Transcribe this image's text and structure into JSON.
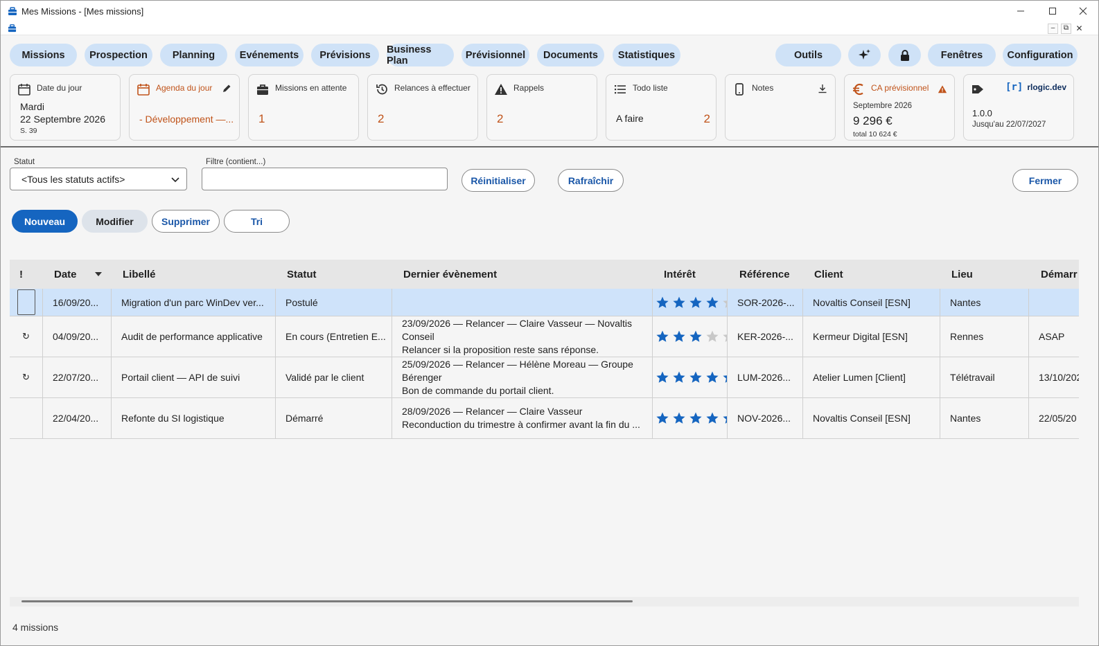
{
  "window": {
    "title": "Mes Missions - [Mes missions]"
  },
  "menu": {
    "items": [
      "Missions",
      "Prospection",
      "Planning",
      "Evénements",
      "Prévisions",
      "Business Plan",
      "Prévisionnel",
      "Documents",
      "Statistiques"
    ],
    "right": [
      "Outils",
      "Fenêtres",
      "Configuration"
    ]
  },
  "cards": {
    "date": {
      "title": "Date du jour",
      "day": "Mardi",
      "date": "22 Septembre 2026",
      "week": "S. 39"
    },
    "agenda": {
      "title": "Agenda du jour",
      "entry": "- Développement —..."
    },
    "missions": {
      "title": "Missions en attente",
      "value": "1"
    },
    "relances": {
      "title": "Relances à effectuer",
      "value": "2"
    },
    "rappels": {
      "title": "Rappels",
      "value": "2"
    },
    "todo": {
      "title": "Todo liste",
      "label": "A faire",
      "value": "2"
    },
    "notes": {
      "title": "Notes"
    },
    "ca": {
      "title": "CA prévisionnel",
      "month": "Septembre 2026",
      "amount": "9 296 €",
      "total": "total 10 624 €"
    },
    "version": {
      "brand": "rlogic.dev",
      "brand_bracket": "[r]",
      "version": "1.0.0",
      "until": "Jusqu'au 22/07/2027"
    }
  },
  "filters": {
    "status_label": "Statut",
    "status_value": "<Tous les statuts actifs>",
    "filter_label": "Filtre (contient...)",
    "filter_value": "",
    "reset": "Réinitialiser",
    "refresh": "Rafraîchir",
    "close": "Fermer"
  },
  "actions": {
    "new": "Nouveau",
    "edit": "Modifier",
    "delete": "Supprimer",
    "sort": "Tri"
  },
  "table": {
    "headers": [
      "!",
      "Date",
      "Libellé",
      "Statut",
      "Dernier évènement",
      "Intérêt",
      "Référence",
      "Client",
      "Lieu",
      "Démarr"
    ],
    "rows": [
      {
        "flag": "",
        "date": "16/09/20...",
        "libelle": "Migration d'un parc WinDev ver...",
        "statut": "Postulé",
        "event": "",
        "interest": 4,
        "ref": "SOR-2026-...",
        "client": "Novaltis Conseil [ESN]",
        "lieu": "Nantes",
        "start": ""
      },
      {
        "flag": "↻",
        "date": "04/09/20...",
        "libelle": "Audit de performance applicative",
        "statut": "En cours (Entretien E...",
        "event": "23/09/2026 — Relancer — Claire Vasseur — Novaltis Conseil\nRelancer si la proposition reste sans réponse.",
        "interest": 3,
        "ref": "KER-2026-...",
        "client": "Kermeur Digital [ESN]",
        "lieu": "Rennes",
        "start": "ASAP"
      },
      {
        "flag": "↻",
        "date": "22/07/20...",
        "libelle": "Portail client — API de suivi",
        "statut": "Validé par le client",
        "event": "25/09/2026 — Relancer — Hélène Moreau — Groupe Bérenger\nBon de commande du portail client.",
        "interest": 4.5,
        "ref": "LUM-2026...",
        "client": "Atelier Lumen [Client]",
        "lieu": "Télétravail",
        "start": "13/10/202"
      },
      {
        "flag": "",
        "date": "22/04/20...",
        "libelle": "Refonte du SI logistique",
        "statut": "Démarré",
        "event": "28/09/2026 — Relancer — Claire Vasseur\nReconduction du trimestre à confirmer avant la fin du ...",
        "interest": 5,
        "ref": "NOV-2026...",
        "client": "Novaltis Conseil [ESN]",
        "lieu": "Nantes",
        "start": "22/05/20"
      }
    ]
  },
  "status_bar": "4 missions",
  "colors": {
    "accent": "#1565c0",
    "pill": "#cfe2f7",
    "orange": "#c0531a",
    "selected_row": "#cfe3fa",
    "star": "#1565c0",
    "star_empty": "#c8c8c8"
  }
}
